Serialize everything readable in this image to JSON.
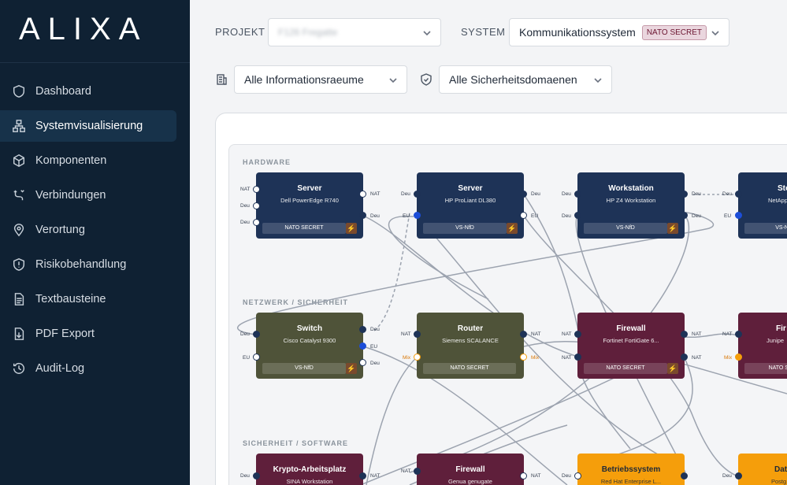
{
  "app": {
    "logo": "ALIXA"
  },
  "sidebar": {
    "items": [
      {
        "label": "Dashboard",
        "icon": "shield-icon"
      },
      {
        "label": "Systemvisualisierung",
        "icon": "network-icon"
      },
      {
        "label": "Komponenten",
        "icon": "cube-icon"
      },
      {
        "label": "Verbindungen",
        "icon": "connection-icon"
      },
      {
        "label": "Verortung",
        "icon": "map-pin-icon"
      },
      {
        "label": "Risikobehandlung",
        "icon": "shield-alert-icon"
      },
      {
        "label": "Textbausteine",
        "icon": "document-icon"
      },
      {
        "label": "PDF Export",
        "icon": "file-export-icon"
      },
      {
        "label": "Audit-Log",
        "icon": "history-icon"
      }
    ]
  },
  "toolbar": {
    "project_label": "PROJEKT",
    "project_value": "F126 Fregatte",
    "system_label": "SYSTEM",
    "system_value": "Kommunikationssystem",
    "system_badge": "NATO SECRET",
    "room_filter": "Alle Informationsraeume",
    "domain_filter": "Alle Sicherheitsdomaenen"
  },
  "sections": {
    "hardware": "HARDWARE",
    "network": "NETZWERK / SICHERHEIT",
    "software": "SICHERHEIT / SOFTWARE"
  },
  "nodes": {
    "hw1": {
      "title": "Server",
      "sub": "Dell PowerEdge R740",
      "cls": "NATO SECRET"
    },
    "hw2": {
      "title": "Server",
      "sub": "HP ProLiant DL380",
      "cls": "VS-NfD"
    },
    "hw3": {
      "title": "Workstation",
      "sub": "HP Z4 Workstation",
      "cls": "VS-NfD"
    },
    "hw4": {
      "title": "Sto",
      "sub": "NetApp",
      "cls": "VS-N"
    },
    "net1": {
      "title": "Switch",
      "sub": "Cisco Catalyst 9300",
      "cls": "VS-NfD"
    },
    "net2": {
      "title": "Router",
      "sub": "Siemens SCALANCE",
      "cls": "NATO SECRET"
    },
    "net3": {
      "title": "Firewall",
      "sub": "Fortinet FortiGate 6...",
      "cls": "NATO SECRET"
    },
    "net4": {
      "title": "Fir",
      "sub": "Junipe",
      "cls": "NATO S"
    },
    "sw1": {
      "title": "Krypto-Arbeitsplatz",
      "sub": "SINA Workstation"
    },
    "sw2": {
      "title": "Firewall",
      "sub": "Genua genugate"
    },
    "sw3": {
      "title": "Betriebssystem",
      "sub": "Red Hat Enterprise L..."
    },
    "sw4": {
      "title": "Dat",
      "sub": "Postg"
    }
  },
  "ports": {
    "nat": "NAT",
    "deu": "Deu",
    "eu": "EU",
    "mix": "Mix"
  },
  "icons": {
    "bolt": "⚡"
  }
}
